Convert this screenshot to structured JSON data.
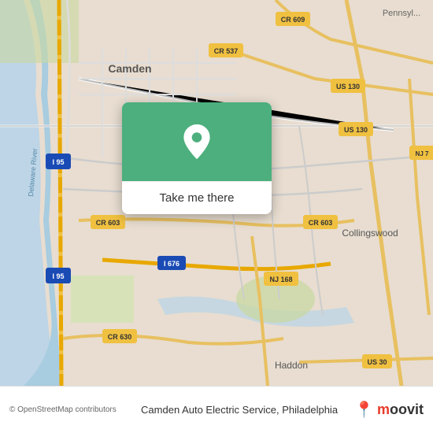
{
  "map": {
    "background_color": "#e8e0d8",
    "attribution": "© OpenStreetMap contributors",
    "location_label": "Camden Auto Electric Service, Philadelphia"
  },
  "popup": {
    "background_color": "#4caf7d",
    "button_label": "Take me there"
  },
  "moovit": {
    "logo_text": "moovit",
    "pin_color": "#e8392a"
  },
  "roads": [
    {
      "id": "i95_left",
      "label": "I 95"
    },
    {
      "id": "cr609",
      "label": "CR 609"
    },
    {
      "id": "cr537",
      "label": "CR 537"
    },
    {
      "id": "us130_top",
      "label": "US 130"
    },
    {
      "id": "us130_right",
      "label": "US 130"
    },
    {
      "id": "cr603_left",
      "label": "CR 603"
    },
    {
      "id": "cr603_right",
      "label": "CR 603"
    },
    {
      "id": "i676",
      "label": "I 676"
    },
    {
      "id": "nj168",
      "label": "NJ 168"
    },
    {
      "id": "cr630",
      "label": "CR 630"
    },
    {
      "id": "us30",
      "label": "US 30"
    },
    {
      "id": "nj7",
      "label": "NJ 7"
    },
    {
      "id": "camden_label",
      "label": "Camden"
    },
    {
      "id": "collingswood_label",
      "label": "Collingswood"
    },
    {
      "id": "haddon_label",
      "label": "Haddon"
    },
    {
      "id": "pennsylvania_label",
      "label": "Pennsyl..."
    }
  ]
}
